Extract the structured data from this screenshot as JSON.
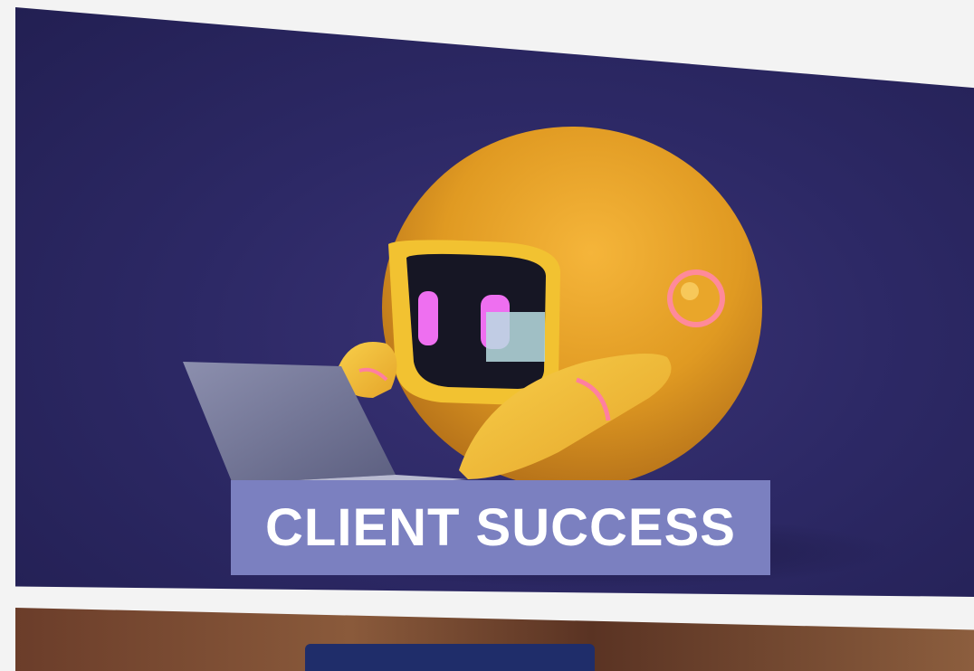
{
  "hero": {
    "banner_text": "CLIENT SUCCESS",
    "colors": {
      "background": "#2d2966",
      "banner": "#7b80c0",
      "robot": "#e8a42a"
    }
  },
  "second_image": {
    "icon": "laptop-photo"
  }
}
